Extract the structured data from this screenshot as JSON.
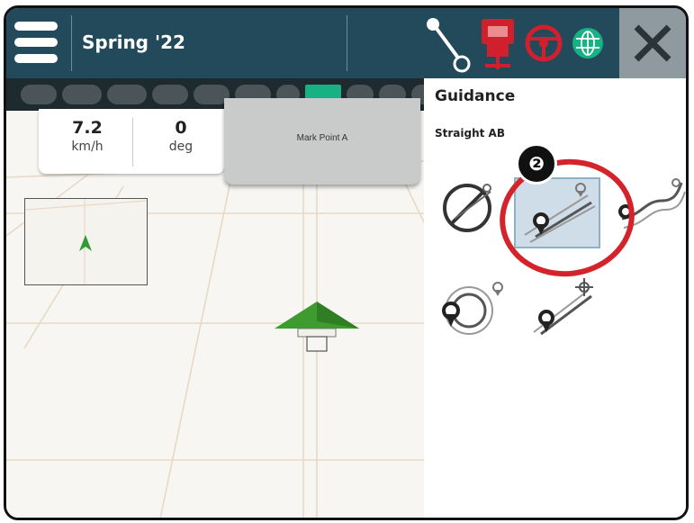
{
  "header": {
    "job_name": "Spring '22",
    "icons": [
      "menu-icon",
      "ab-line-icon",
      "implement-alert-icon",
      "steering-wheel-icon",
      "gnss-globe-icon",
      "close-icon"
    ],
    "colors": {
      "bar": "#234a5a",
      "alert": "#d01f2d",
      "gnss": "#17b184",
      "close_bg": "#8f9aa0"
    }
  },
  "swath_bar": {
    "sections": 11,
    "active_section": 8
  },
  "speed_panel": {
    "speed_value": "7.2",
    "speed_unit": "km/h",
    "heading_value": "0",
    "heading_unit": "deg"
  },
  "mark_point": {
    "label": "Mark Point A"
  },
  "guidance_panel": {
    "title": "Guidance",
    "mode": "Straight AB",
    "options": [
      {
        "icon": "no-guidance-icon",
        "selected": false
      },
      {
        "icon": "straight-ab-icon",
        "selected": true
      },
      {
        "icon": "curved-ab-icon",
        "selected": false
      },
      {
        "icon": "circle-pivot-icon",
        "selected": false
      },
      {
        "icon": "last-pass-icon",
        "selected": false
      }
    ]
  },
  "callout": {
    "number": "❷",
    "color": "#d5232b"
  }
}
